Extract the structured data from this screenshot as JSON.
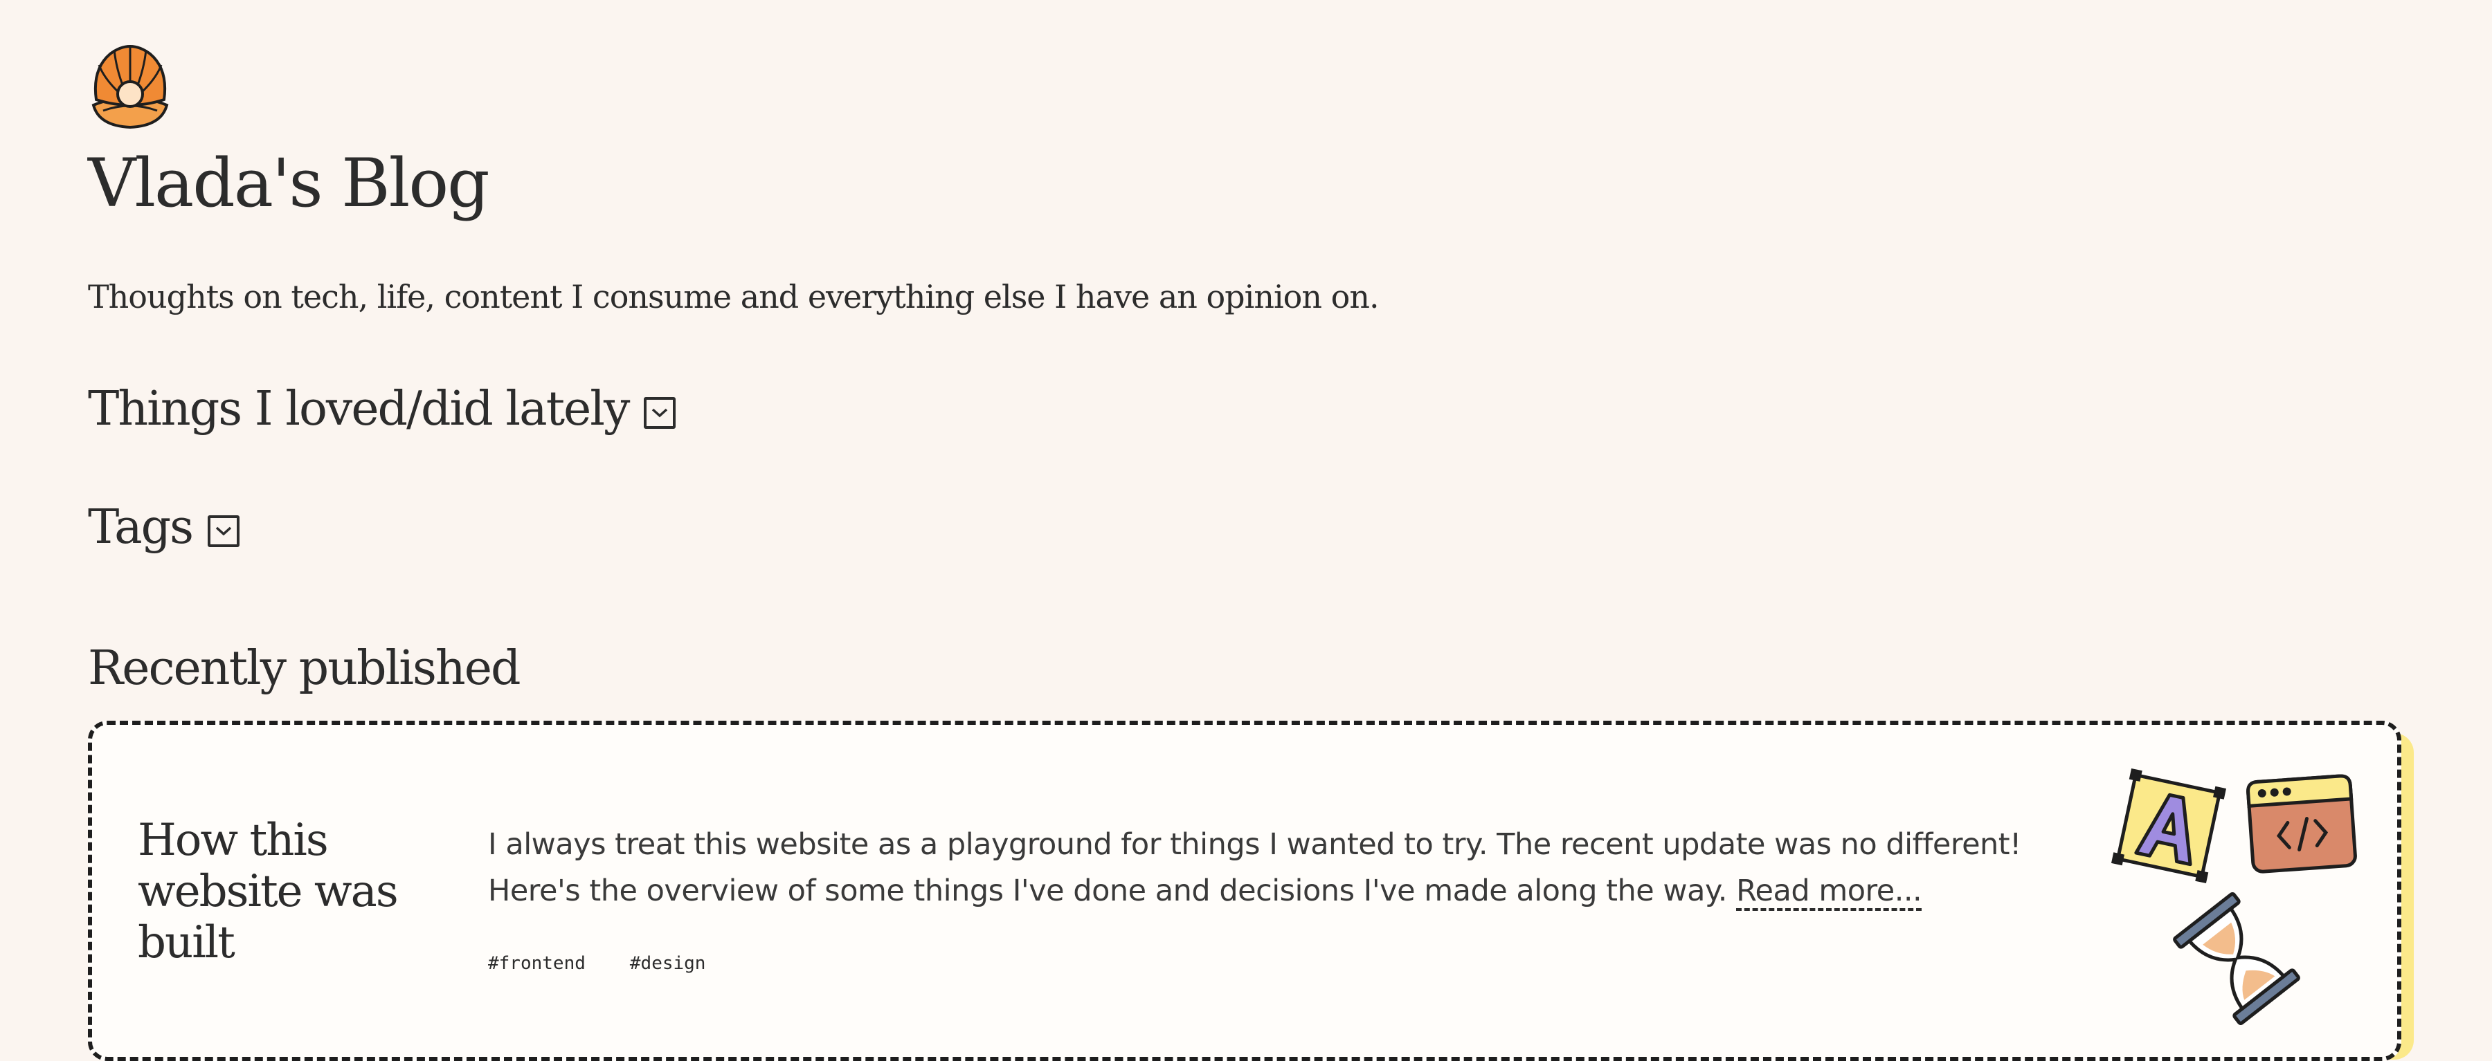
{
  "site": {
    "title": "Vlada's Blog",
    "tagline": "Thoughts on tech, life, content I consume and everything else I have an opinion on."
  },
  "sections": {
    "loved": "Things I loved/did lately",
    "tags": "Tags"
  },
  "recent": {
    "heading": "Recently published",
    "post": {
      "title": "How this website was built",
      "excerpt": "I always treat this website as a playground for things I wanted to try. The recent update was no different! Here's the overview of some things I've done and decisions I've made along the way. ",
      "read_more": "Read more...",
      "tags": [
        "#frontend",
        "#design"
      ]
    }
  },
  "icons": {
    "logo": "seashell-pearl-icon",
    "toggle": "chevron-down-box-icon",
    "illustrations": [
      "letter-a-icon",
      "code-window-icon",
      "hourglass-icon"
    ]
  },
  "colors": {
    "background": "#fbf5f0",
    "card_shadow": "#fbe98a",
    "logo_orange": "#f08a34",
    "code_window": "#d9896a",
    "letter_a": "#9f8ce0",
    "text": "#2c2c2c"
  }
}
